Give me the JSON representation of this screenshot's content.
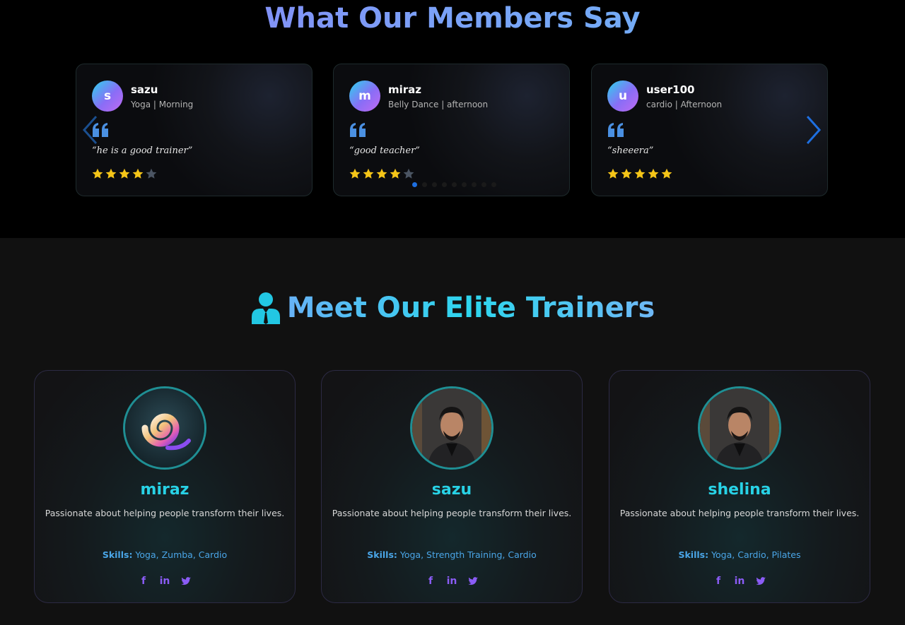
{
  "testimonials": {
    "title": "What Our Members Say",
    "reviews": [
      {
        "initial": "s",
        "name": "sazu",
        "subtitle": "Yoga | Morning",
        "quote": "“he is a good trainer”",
        "rating": 4,
        "max_rating": 5
      },
      {
        "initial": "m",
        "name": "miraz",
        "subtitle": "Belly Dance | afternoon",
        "quote": "“good teacher”",
        "rating": 4,
        "max_rating": 5
      },
      {
        "initial": "u",
        "name": "user100",
        "subtitle": "cardio | Afternoon",
        "quote": "“sheeera”",
        "rating": 5,
        "max_rating": 5
      }
    ],
    "pagination": {
      "total": 9,
      "active": 0
    },
    "colors": {
      "star_filled": "#f5c518",
      "star_empty": "#4b5563",
      "arrow": "#1e6fe0"
    }
  },
  "trainers": {
    "title": "Meet Our Elite Trainers",
    "skills_label": "Skills:",
    "cards": [
      {
        "name": "miraz",
        "photo": "spiral-logo",
        "bio": "Passionate about helping people transform their lives.",
        "skills": "Yoga, Zumba, Cardio",
        "social": [
          "facebook-icon",
          "linkedin-icon",
          "twitter-icon"
        ]
      },
      {
        "name": "sazu",
        "photo": "portrait",
        "bio": "Passionate about helping people transform their lives.",
        "skills": "Yoga, Strength Training, Cardio",
        "social": [
          "facebook-icon",
          "linkedin-icon",
          "twitter-icon"
        ]
      },
      {
        "name": "shelina",
        "photo": "portrait",
        "bio": "Passionate about helping people transform their lives.",
        "skills": "Yoga, Cardio, Pilates",
        "social": [
          "facebook-icon",
          "linkedin-icon",
          "twitter-icon"
        ]
      }
    ],
    "colors": {
      "accent": "#28d2e6",
      "skills": "#4aa6e8",
      "social": "#8b5cf6"
    }
  }
}
